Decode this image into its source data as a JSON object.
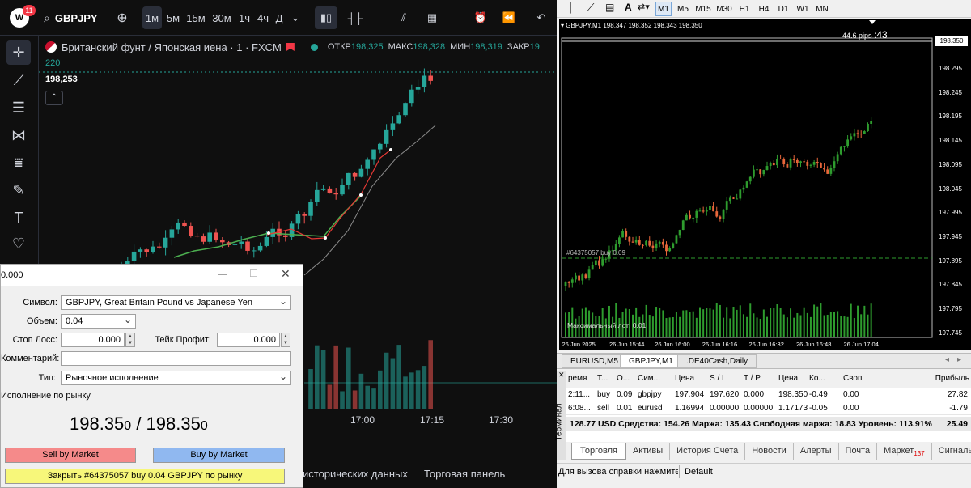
{
  "colors": {
    "up": "#26a69a",
    "down": "#ef5350",
    "accent": "#2962ff"
  },
  "tv": {
    "badge": "11",
    "symbol": "GBPJPY",
    "intervals": [
      "1м",
      "5м",
      "15м",
      "30м",
      "1ч",
      "4ч",
      "Д"
    ],
    "legend": {
      "title": "Британский фунт / Японская иена · 1 · FXCM",
      "open_label": "ОТКР",
      "open": "198,325",
      "high_label": "МАКС",
      "high": "198,328",
      "low_label": "МИН",
      "low": "198,319",
      "close_label": "ЗАКР",
      "close": "19",
      "volume": "220",
      "price_box": "198,253"
    },
    "time_labels": [
      "17:00",
      "17:15",
      "17:30"
    ],
    "bottom_items": [
      "исторических данных",
      "Торговая панель"
    ]
  },
  "dialog": {
    "title": "0.000",
    "symbol_label": "Символ:",
    "symbol_value": "GBPJPY, Great Britain Pound vs Japanese Yen",
    "volume_label": "Объем:",
    "volume_value": "0.04",
    "sl_label": "Стоп Лосс:",
    "sl_value": "0.000",
    "tp_label": "Тейк Профит:",
    "tp_value": "0.000",
    "comment_label": "Комментарий:",
    "comment_value": "",
    "type_label": "Тип:",
    "type_value": "Рыночное исполнение",
    "market_label": "Исполнение по рынку",
    "bid_main": "198.35",
    "bid_small": "0",
    "sep": " / ",
    "ask_main": "198.35",
    "ask_small": "0",
    "sell_label": "Sell by Market",
    "buy_label": "Buy by Market",
    "close_label": "Закрыть #64375057 buy 0.04 GBPJPY по рынку"
  },
  "mt": {
    "timeframes": [
      "M1",
      "M5",
      "M15",
      "M30",
      "H1",
      "H4",
      "D1",
      "W1",
      "MN"
    ],
    "chart_header": "GBPJPY,M1  198.347 198.352 198.343 198.350",
    "pips": "44.6 pips",
    "pips_sec": ":43",
    "price_labels": [
      "198.350",
      "198.295",
      "198.245",
      "198.195",
      "198.145",
      "198.095",
      "198.045",
      "197.995",
      "197.945",
      "197.895",
      "197.845",
      "197.795",
      "197.745"
    ],
    "order_line_label": "#64375057 buy 0.09",
    "max_lot_label": "Максимальный лот: 0.01",
    "time_labels": [
      "26 Jun 2025",
      "26 Jun 15:44",
      "26 Jun 16:00",
      "26 Jun 16:16",
      "26 Jun 16:32",
      "26 Jun 16:48",
      "26 Jun 17:04"
    ],
    "chart_tabs": [
      "EURUSD,M5",
      "GBPJPY,M1",
      ".DE40Cash,Daily"
    ],
    "table": {
      "headers": [
        "ремя",
        "Т...",
        "О...",
        "Сим...",
        "Цена",
        "S / L",
        "T / P",
        "Цена",
        "Ко...",
        "Своп",
        "Прибыль"
      ],
      "rows": [
        [
          "2:11...",
          "buy",
          "0.09",
          "gbpjpy",
          "197.904",
          "197.620",
          "0.000",
          "198.350",
          "-0.49",
          "0.00",
          "27.82"
        ],
        [
          "6:08...",
          "sell",
          "0.01",
          "eurusd",
          "1.16994",
          "0.00000",
          "0.00000",
          "1.17173",
          "-0.05",
          "0.00",
          "-1.79"
        ]
      ],
      "summary": "128.77 USD  Средства: 154.26  Маржа: 135.43  Свободная маржа: 18.83  Уровень: 113.91%",
      "summary_profit": "25.49"
    },
    "terminal_label": "Терминал",
    "bottom_tabs": [
      "Торговля",
      "Активы",
      "История Счета",
      "Новости",
      "Алерты",
      "Почта",
      "Маркет",
      "Сигналы"
    ],
    "market_badge": "137",
    "status_help": "Для вызова справки нажмите F1",
    "status_profile": "Default"
  }
}
